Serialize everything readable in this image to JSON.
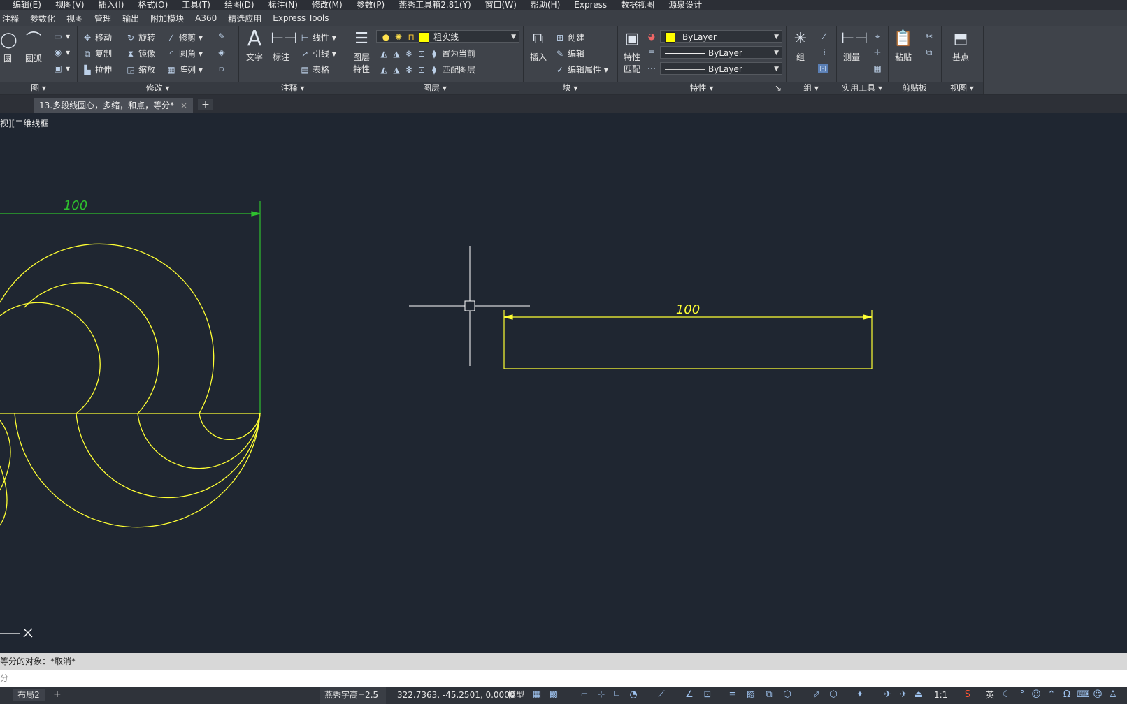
{
  "menubar": [
    "编辑(E)",
    "视图(V)",
    "插入(I)",
    "格式(O)",
    "工具(T)",
    "绘图(D)",
    "标注(N)",
    "修改(M)",
    "参数(P)",
    "燕秀工具箱2.81(Y)",
    "窗口(W)",
    "帮助(H)",
    "Express",
    "数据视图",
    "源泉设计"
  ],
  "ribbon_tabs": [
    "注释",
    "参数化",
    "视图",
    "管理",
    "输出",
    "附加模块",
    "A360",
    "精选应用",
    "Express Tools"
  ],
  "ribbon": {
    "draw": {
      "circle": "圆",
      "arc": "圆弧",
      "title": "图"
    },
    "modify": {
      "move": "移动",
      "rotate": "旋转",
      "trim": "修剪",
      "copy": "复制",
      "mirror": "镜像",
      "fillet": "圆角",
      "stretch": "拉伸",
      "scale": "缩放",
      "array": "阵列",
      "title": "修改"
    },
    "annotation": {
      "text": "文字",
      "dimension": "标注",
      "linear": "线性",
      "leader": "引线",
      "table": "表格",
      "title": "注释"
    },
    "layers": {
      "layer_props_1": "图层",
      "layer_props_2": "特性",
      "current_layer": "粗实线",
      "set_current": "置为当前",
      "match_layer": "匹配图层",
      "title": "图层"
    },
    "block": {
      "insert": "插入",
      "create": "创建",
      "edit": "编辑",
      "edit_attr": "编辑属性",
      "title": "块"
    },
    "properties": {
      "match_1": "特性",
      "match_2": "匹配",
      "color": "ByLayer",
      "linetype": "ByLayer",
      "lineweight": "ByLayer",
      "title": "特性"
    },
    "groups": {
      "group": "组",
      "title": "组"
    },
    "utilities": {
      "measure": "测量",
      "title": "实用工具"
    },
    "clipboard": {
      "paste": "粘贴",
      "title": "剪贴板"
    },
    "view": {
      "base": "基点",
      "title": "视图"
    }
  },
  "doc_tab": {
    "title": "13.多段线圆心，多缩，和点，等分*",
    "close": "×",
    "new": "+"
  },
  "viewport_label": "视][二维线框",
  "drawing": {
    "dim_left": "100",
    "dim_right": "100"
  },
  "command": {
    "history": "等分的对象：*取消*",
    "prompt": "分"
  },
  "status": {
    "layout_tab": "布局2",
    "layout_add": "+",
    "text_height": "燕秀字高=2.5",
    "coords": "322.7363, -45.2501, 0.0000",
    "model": "模型",
    "scale": "1:1",
    "ime": "英"
  },
  "colors": {
    "drawing_yellow": "#ffff33",
    "dimension_green": "#2ec02e",
    "canvas_bg": "#1f2631"
  }
}
